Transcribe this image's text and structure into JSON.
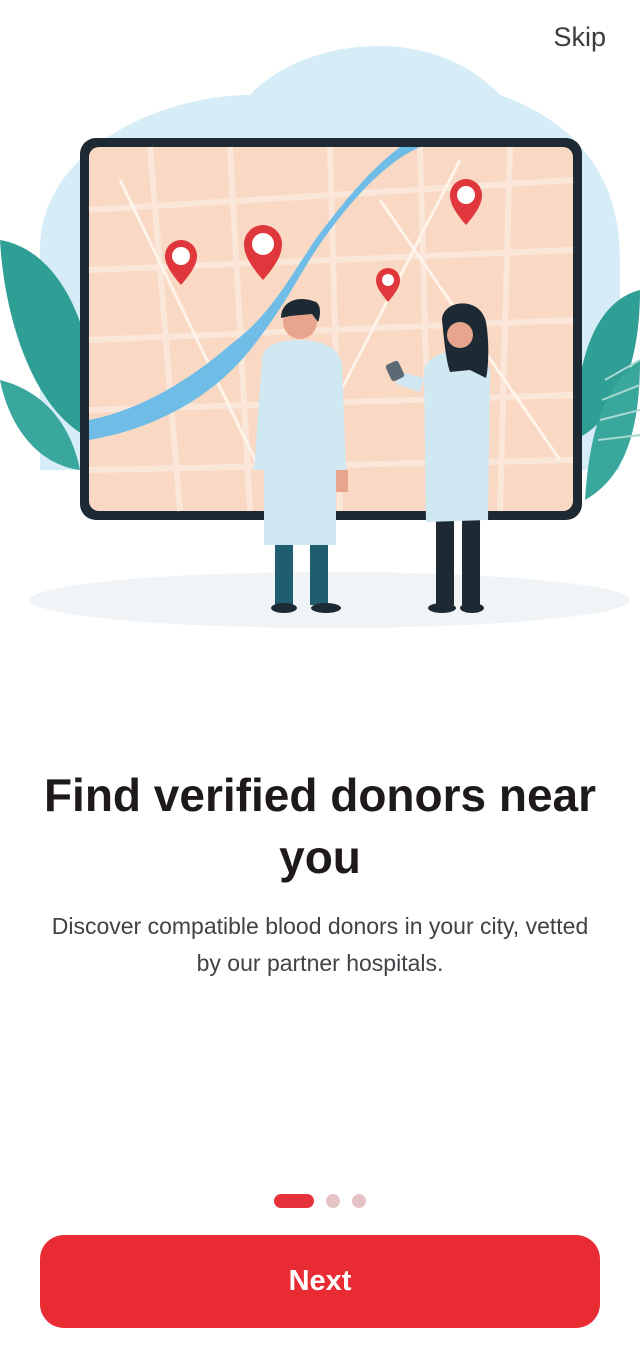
{
  "header": {
    "skip_label": "Skip"
  },
  "onboarding": {
    "title": "Find verified donors near you",
    "subtitle": "Discover compatible blood donors in your city, vetted by our partner hospitals.",
    "current_step": 1,
    "total_steps": 3
  },
  "footer": {
    "next_label": "Next"
  },
  "colors": {
    "accent": "#e92b33",
    "dot_inactive": "#e6c3c6",
    "map_bg": "#f9d9c4",
    "river": "#6fbde6",
    "blob": "#d6ecf7",
    "leaf": "#2f9e95"
  },
  "illustration": {
    "icons": [
      "map-screen-icon",
      "heart-pin-icon",
      "doctor-icon",
      "leaf-icon"
    ]
  }
}
